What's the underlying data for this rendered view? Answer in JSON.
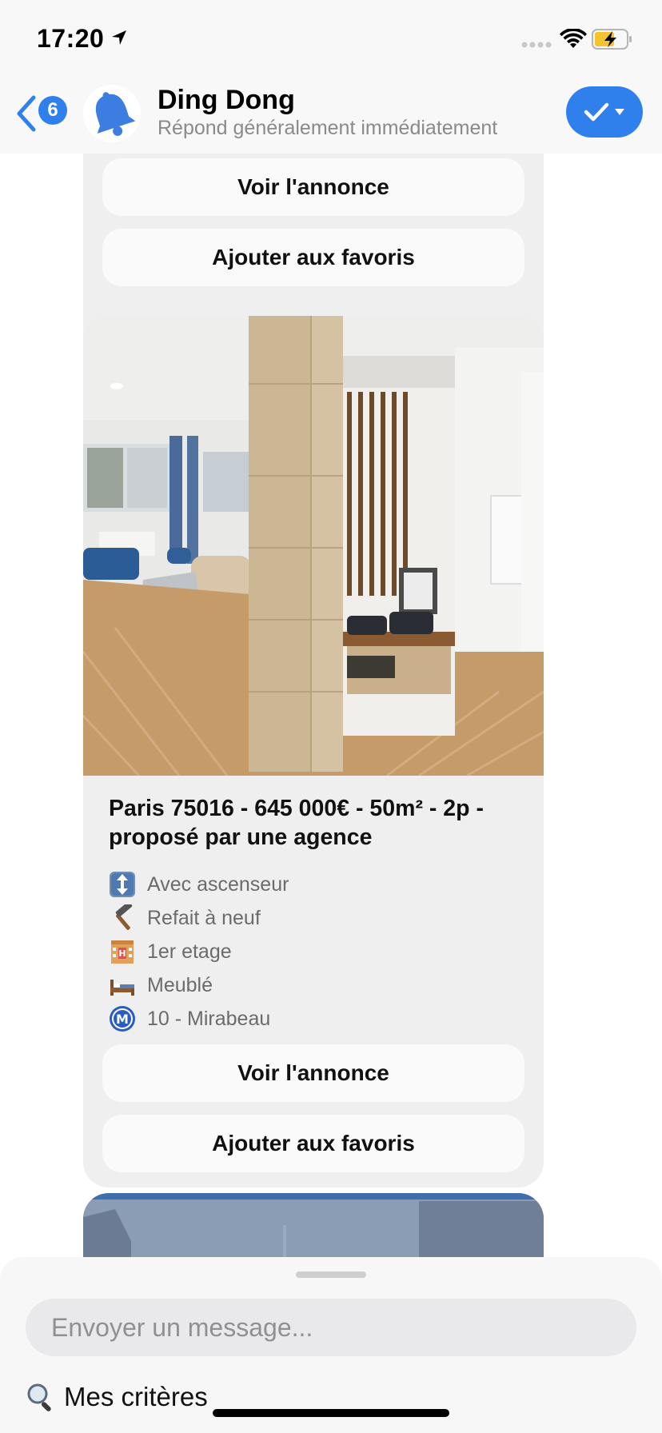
{
  "status_bar": {
    "time": "17:20"
  },
  "header": {
    "back_badge": "6",
    "title": "Ding Dong",
    "subtitle": "Répond généralement immédiatement",
    "accent_color": "#2f80ed"
  },
  "cards": [
    {
      "buttons": {
        "view": "Voir l'annonce",
        "favorite": "Ajouter aux favoris"
      }
    },
    {
      "title": "Paris 75016 - 645 000€ - 50m² - 2p - proposé par une agence",
      "features": [
        {
          "icon": "elevator-icon",
          "text": "Avec ascenseur"
        },
        {
          "icon": "hammer-icon",
          "text": "Refait à neuf"
        },
        {
          "icon": "building-icon",
          "text": "1er etage"
        },
        {
          "icon": "bed-icon",
          "text": "Meublé"
        },
        {
          "icon": "metro-icon",
          "text": "10 - Mirabeau"
        }
      ],
      "buttons": {
        "view": "Voir l'annonce",
        "favorite": "Ajouter aux favoris"
      }
    }
  ],
  "composer": {
    "placeholder": "Envoyer un message...",
    "criteria_label": "Mes critères"
  }
}
